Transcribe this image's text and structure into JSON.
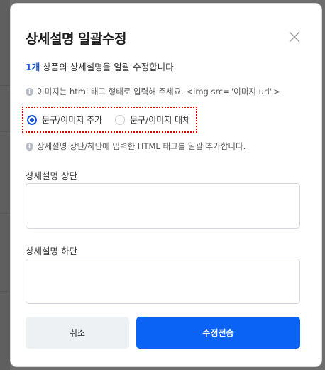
{
  "dialog": {
    "title": "상세설명 일괄수정",
    "intro_count": "1개",
    "intro_text": " 상품의 상세설명을 일괄 수정합니다.",
    "note1": "이미지는 html 태그 형태로 입력해 주세요. <img src=\"이미지 url\">",
    "note2": "상세설명 상단/하단에 입력한 HTML 태그를 일괄 추가합니다.",
    "info_icon": "i",
    "radio_options": [
      {
        "label": "문구/이미지 추가",
        "selected": true
      },
      {
        "label": "문구/이미지 대체",
        "selected": false
      }
    ],
    "top_label": "상세설명 상단",
    "top_value": "",
    "bottom_label": "상세설명 하단",
    "bottom_value": "",
    "cancel_label": "취소",
    "submit_label": "수정전송"
  },
  "icons": {
    "close": "close-icon",
    "info": "info-icon"
  },
  "colors": {
    "accent": "#0a63f5",
    "count_text": "#1a56d6",
    "highlight_border": "#e00000",
    "cancel_bg": "#eef1f4"
  }
}
